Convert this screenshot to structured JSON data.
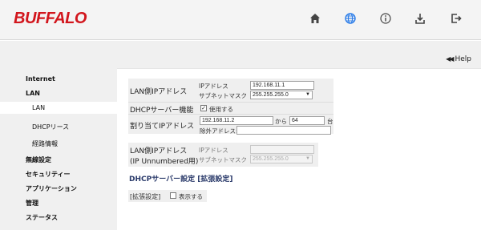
{
  "header": {
    "logo": "BUFFALO",
    "icons": [
      "home-icon",
      "globe-icon",
      "info-icon",
      "download-icon",
      "logout-icon"
    ]
  },
  "help": {
    "arrows": "◀◀",
    "label": "Help"
  },
  "sidebar": {
    "items": [
      {
        "label": "Internet"
      },
      {
        "label": "LAN"
      },
      {
        "label": "LAN"
      },
      {
        "label": "DHCPリース"
      },
      {
        "label": "経路情報"
      },
      {
        "label": "無線設定"
      },
      {
        "label": "セキュリティー"
      },
      {
        "label": "アプリケーション"
      },
      {
        "label": "管理"
      },
      {
        "label": "ステータス"
      }
    ]
  },
  "lan_ip": {
    "label": "LAN側IPアドレス",
    "ip_label": "IPアドレス",
    "ip_value": "192.168.11.1",
    "mask_label": "サブネットマスク",
    "mask_value": "255.255.255.0"
  },
  "dhcp_server": {
    "label": "DHCPサーバー機能",
    "checked": "✓",
    "option": "使用する"
  },
  "assign": {
    "label": "割り当てIPアドレス",
    "start_value": "192.168.11.2",
    "from": "から",
    "count_value": "64",
    "unit": "台",
    "exclude_label": "除外アドレス:",
    "exclude_value": ""
  },
  "unnumbered": {
    "label_line1": "LAN側IPアドレス",
    "label_line2": "(IP Unnumbered用)",
    "ip_label": "IPアドレス",
    "ip_value": "",
    "mask_label": "サブネットマスク",
    "mask_value": "255.255.255.0"
  },
  "dhcp_ext": {
    "title": "DHCPサーバー設定 [拡張設定]",
    "label": "[拡張設定]",
    "option": "表示する"
  }
}
